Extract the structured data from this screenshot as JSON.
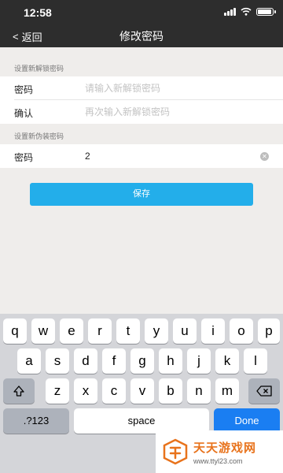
{
  "status_bar": {
    "time": "12:58",
    "battery_level": 0.85
  },
  "nav": {
    "back_label": "返回",
    "back_chevron": "<",
    "title": "修改密码"
  },
  "unlock_section": {
    "header": "设置新解锁密码",
    "password_label": "密码",
    "password_placeholder": "请输入新解锁密码",
    "confirm_label": "确认",
    "confirm_placeholder": "再次输入新解锁密码"
  },
  "disguise_section": {
    "header": "设置新伪装密码",
    "password_label": "密码",
    "password_value": "2"
  },
  "save_button": "保存",
  "keyboard": {
    "row1": [
      "q",
      "w",
      "e",
      "r",
      "t",
      "y",
      "u",
      "i",
      "o",
      "p"
    ],
    "row2": [
      "a",
      "s",
      "d",
      "f",
      "g",
      "h",
      "j",
      "k",
      "l"
    ],
    "row3": [
      "z",
      "x",
      "c",
      "v",
      "b",
      "n",
      "m"
    ],
    "numbers_key": ".?123",
    "space_key": "space",
    "done_key": "Done",
    "shift_icon": "shift-arrow-icon",
    "delete_icon": "backspace-icon"
  },
  "watermark": {
    "title": "天天游戏网",
    "url": "www.ttyl23.com",
    "accent": "#e8731c"
  },
  "colors": {
    "nav_background": "#2d2d2d",
    "primary_button": "#23aeea",
    "done_key": "#1a7ef2"
  }
}
